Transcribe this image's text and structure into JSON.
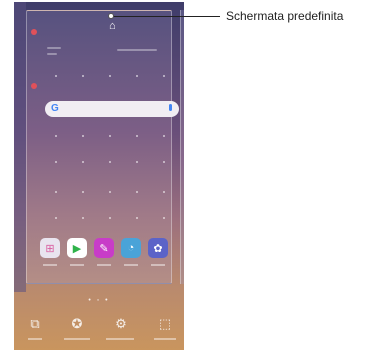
{
  "callout": {
    "text": "Schermata predefinita"
  },
  "home_icon": "home-icon",
  "search_widget": {
    "logo": "G",
    "mic_icon": "mic-icon"
  },
  "dock_apps": [
    {
      "name": "app-folder-icon",
      "glyph": "⊞",
      "color": "#d95da0"
    },
    {
      "name": "play-store-icon",
      "glyph": "▶",
      "color": "#ffffff"
    },
    {
      "name": "pen-icon",
      "glyph": "✎",
      "color": "#c83cc8"
    },
    {
      "name": "music-icon",
      "glyph": "◔",
      "color": "#4aa3d8"
    },
    {
      "name": "settings-icon",
      "glyph": "✿",
      "color": "#5b63c8"
    }
  ],
  "page_indicator": "• ◦ •",
  "bottom_bar": [
    {
      "name": "widgets-icon",
      "glyph": "⧉"
    },
    {
      "name": "theme-icon",
      "glyph": "✪"
    },
    {
      "name": "home-settings-icon",
      "glyph": "⚙"
    },
    {
      "name": "wallpaper-icon",
      "glyph": "⬚"
    }
  ],
  "colors": {
    "accent_red": "#e0515a",
    "google_blue": "#4285f4"
  }
}
